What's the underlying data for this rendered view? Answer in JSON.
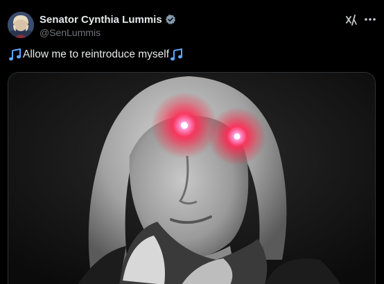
{
  "author": {
    "display_name": "Senator Cynthia Lummis",
    "handle": "@SenLummis",
    "verified_color": "#829aab",
    "avatar_icon": "profile-photo"
  },
  "header_actions": {
    "grok_icon": "grok-icon",
    "more_icon": "ellipsis-icon"
  },
  "tweet": {
    "text": "Allow me to reintroduce myself",
    "leading_emoji": "musical-notes-icon",
    "trailing_emoji": "musical-notes-icon"
  },
  "media": {
    "type": "photo",
    "subject": "black-and-white portrait with glowing red laser eyes",
    "eye_glow_color": "#ff2a55"
  },
  "colors": {
    "background": "#000000",
    "primary_text": "#e7e9ea",
    "secondary_text": "#71767b",
    "emoji_blue": "#5aa8ff"
  }
}
